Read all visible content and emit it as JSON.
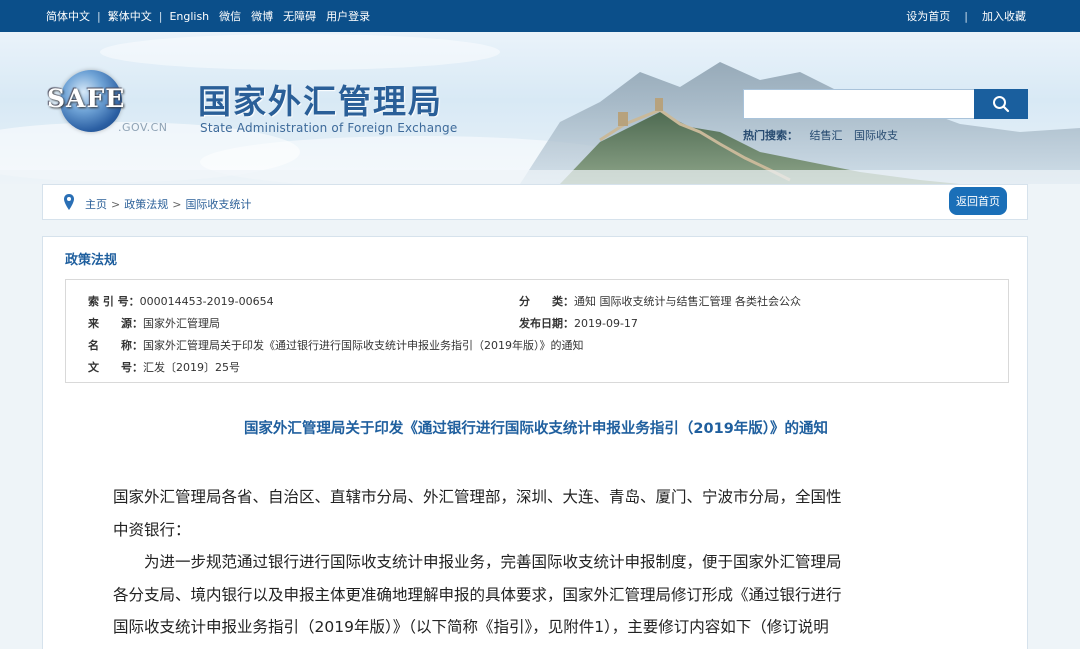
{
  "topbar": {
    "left": [
      "简体中文",
      "繁体中文",
      "English",
      "微信",
      "微博",
      "无障碍",
      "用户登录"
    ],
    "right": [
      "设为首页",
      "加入收藏"
    ]
  },
  "header": {
    "logo_text": "SAFE",
    "logo_domain": ".GOV.CN",
    "title_cn": "国家外汇管理局",
    "title_en": "State Administration of Foreign Exchange",
    "search": {
      "value": "",
      "placeholder": ""
    },
    "hot": {
      "label": "热门搜索：",
      "items": [
        "结售汇",
        "国际收支"
      ]
    }
  },
  "breadcrumb": {
    "items": [
      "主页",
      "政策法规",
      "国际收支统计"
    ],
    "separator": ">",
    "back_button": "返回首页"
  },
  "section_title": "政策法规",
  "meta": {
    "index": {
      "label": "索 引 号：",
      "value": "000014453-2019-00654"
    },
    "category": {
      "label": "分　　类：",
      "value": "通知  国际收支统计与结售汇管理  各类社会公众"
    },
    "source": {
      "label": "来　　源：",
      "value": "国家外汇管理局"
    },
    "date": {
      "label": "发布日期：",
      "value": "2019-09-17"
    },
    "name": {
      "label": "名　　称：",
      "value": "国家外汇管理局关于印发《通过银行进行国际收支统计申报业务指引（2019年版）》的通知"
    },
    "docno": {
      "label": "文　　号：",
      "value": "汇发〔2019〕25号"
    }
  },
  "document": {
    "title": "国家外汇管理局关于印发《通过银行进行国际收支统计申报业务指引（2019年版）》的通知",
    "para1_line1": "国家外汇管理局各省、自治区、直辖市分局、外汇管理部，深圳、大连、青岛、厦门、宁波市分局，全国性",
    "para1_line2": "中资银行：",
    "para2_line1": "为进一步规范通过银行进行国际收支统计申报业务，完善国际收支统计申报制度，便于国家外汇管理局",
    "para2_line2": "各分支局、境内银行以及申报主体更准确地理解申报的具体要求，国家外汇管理局修订形成《通过银行进行",
    "para2_line3": "国际收支统计申报业务指引（2019年版）》（以下简称《指引》，见附件1），主要修订内容如下（修订说明"
  },
  "colors": {
    "topbar": "#0b4f8a",
    "accent": "#1f5f9e",
    "button": "#1a6fb8"
  }
}
